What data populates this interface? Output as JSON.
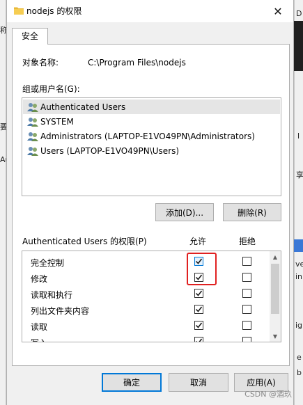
{
  "background": {
    "left_fragments": [
      "称",
      "",
      "要",
      "Au"
    ],
    "right_fragments": [
      "D",
      "",
      "l",
      "享",
      "",
      "ve",
      "in",
      "ig",
      "",
      "e",
      "b"
    ]
  },
  "dialog": {
    "title": "nodejs 的权限",
    "tab": "安全",
    "object_label": "对象名称:",
    "object_value": "C:\\Program Files\\nodejs",
    "group_label": "组或用户名(G):",
    "groups": [
      {
        "name": "Authenticated Users"
      },
      {
        "name": "SYSTEM"
      },
      {
        "name": "Administrators (LAPTOP-E1VO49PN\\Administrators)"
      },
      {
        "name": "Users (LAPTOP-E1VO49PN\\Users)"
      }
    ],
    "add_button": "添加(D)...",
    "remove_button": "删除(R)",
    "perm_label": "Authenticated Users 的权限(P)",
    "allow_header": "允许",
    "deny_header": "拒绝",
    "permissions": [
      {
        "name": "完全控制",
        "allow": true,
        "deny": false
      },
      {
        "name": "修改",
        "allow": true,
        "deny": false
      },
      {
        "name": "读取和执行",
        "allow": true,
        "deny": false
      },
      {
        "name": "列出文件夹内容",
        "allow": true,
        "deny": false
      },
      {
        "name": "读取",
        "allow": true,
        "deny": false
      },
      {
        "name": "写入",
        "allow": true,
        "deny": false
      }
    ],
    "ok_button": "确定",
    "cancel_button": "取消",
    "apply_button": "应用(A)"
  },
  "watermark": "CSDN @酒玖",
  "colors": {
    "accent": "#0078d7",
    "highlight": "#e02020",
    "selection": "#e5e5e5"
  }
}
